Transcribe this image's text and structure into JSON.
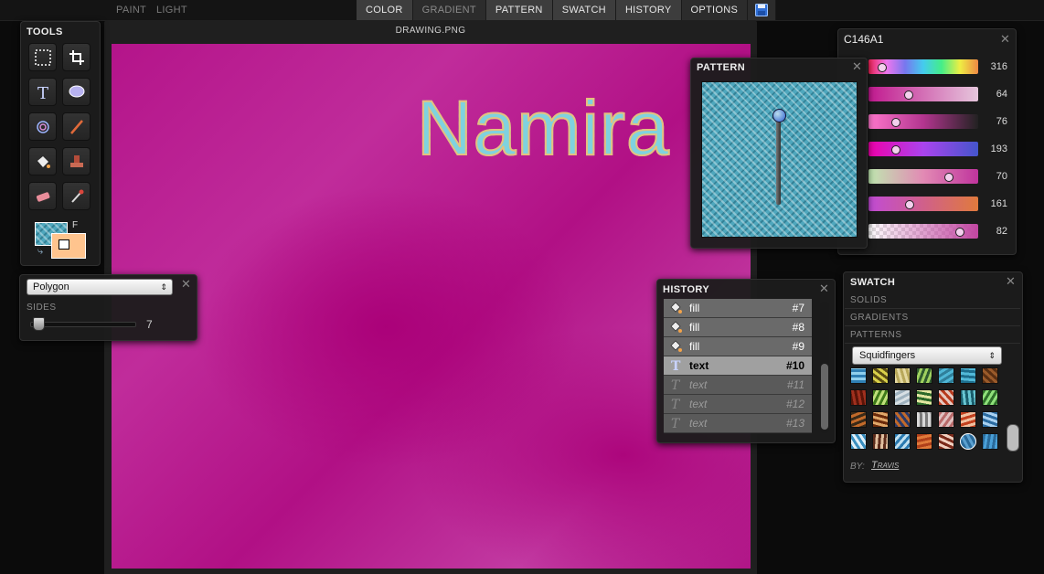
{
  "topbar": {
    "modes": [
      "PAINT",
      "LIGHT"
    ],
    "tabs": [
      "COLOR",
      "GRADIENT",
      "PATTERN",
      "SWATCH",
      "HISTORY",
      "OPTIONS"
    ],
    "save_icon": "floppy-disk-icon"
  },
  "tools": {
    "title": "TOOLS",
    "items": [
      "marquee-select-icon",
      "crop-icon",
      "text-icon",
      "ellipse-icon",
      "spirograph-icon",
      "brush-icon",
      "fill-bucket-icon",
      "stamp-icon",
      "eraser-icon",
      "eyedropper-icon"
    ],
    "fill_label": "F"
  },
  "shape_options": {
    "shape": "Polygon",
    "sides_label": "SIDES",
    "sides_value": "7",
    "sides_fraction": 0.05
  },
  "canvas": {
    "filename": "DRAWING.PNG",
    "text": "Namira"
  },
  "color": {
    "hex": "C146A1",
    "rows": [
      {
        "value": "316",
        "knob": 0.1
      },
      {
        "value": "64",
        "knob": 0.35
      },
      {
        "value": "76",
        "knob": 0.25
      },
      {
        "value": "193",
        "knob": 0.25
      },
      {
        "value": "70",
        "knob": 0.72
      },
      {
        "value": "161",
        "knob": 0.36
      },
      {
        "value": "82",
        "knob": 0.82
      }
    ]
  },
  "pattern": {
    "title": "PATTERN"
  },
  "history": {
    "title": "HISTORY",
    "items": [
      {
        "icon": "fill-bucket-icon",
        "label": "fill",
        "num": "#7",
        "state": "past"
      },
      {
        "icon": "fill-bucket-icon",
        "label": "fill",
        "num": "#8",
        "state": "past"
      },
      {
        "icon": "fill-bucket-icon",
        "label": "fill",
        "num": "#9",
        "state": "past"
      },
      {
        "icon": "text-icon",
        "label": "text",
        "num": "#10",
        "state": "current"
      },
      {
        "icon": "text-icon",
        "label": "text",
        "num": "#11",
        "state": "future"
      },
      {
        "icon": "text-icon",
        "label": "text",
        "num": "#12",
        "state": "future"
      },
      {
        "icon": "text-icon",
        "label": "text",
        "num": "#13",
        "state": "future"
      }
    ]
  },
  "swatch": {
    "title": "SWATCH",
    "sections": [
      "SOLIDS",
      "GRADIENTS",
      "PATTERNS"
    ],
    "selected_set": "Squidfingers",
    "by_label": "BY:",
    "author": "Travis"
  }
}
